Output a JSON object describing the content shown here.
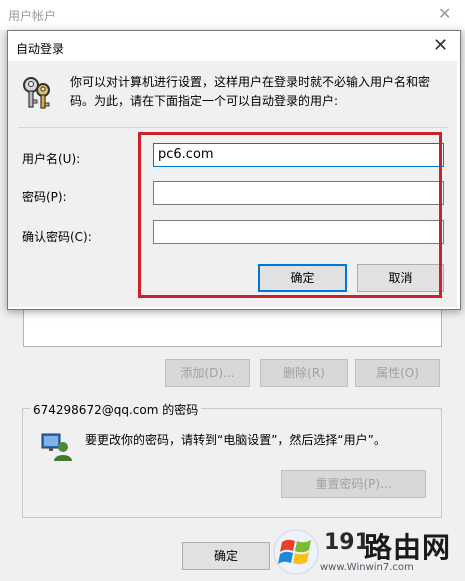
{
  "background_window": {
    "title": "用户帐户",
    "buttons": {
      "add": "添加(D)...",
      "remove": "删除(R)",
      "properties": "属性(O)"
    },
    "password_group": {
      "title": "674298672@qq.com 的密码",
      "message": "要更改你的密码，请转到“电脑设置”，然后选择“用户”。",
      "reset_button": "重置密码(P)..."
    },
    "ok_button": "确定"
  },
  "dialog": {
    "title": "自动登录",
    "description": "你可以对计算机进行设置，这样用户在登录时就不必输入用户名和密码。为此，请在下面指定一个可以自动登录的用户:",
    "fields": {
      "username_label": "用户名(U):",
      "username_value": "pc6.com",
      "password_label": "密码(P):",
      "password_value": "",
      "confirm_label": "确认密码(C):",
      "confirm_value": ""
    },
    "ok_button": "确定",
    "cancel_button": "取消"
  },
  "watermark": {
    "number": "191",
    "brand": "路由网",
    "url": "www.Winwin7.com"
  },
  "colors": {
    "highlight": "#c8232c",
    "focus": "#0078d7"
  },
  "icons": [
    "keys-icon",
    "user-monitor-icon",
    "close-icon",
    "windows-logo-icon"
  ]
}
